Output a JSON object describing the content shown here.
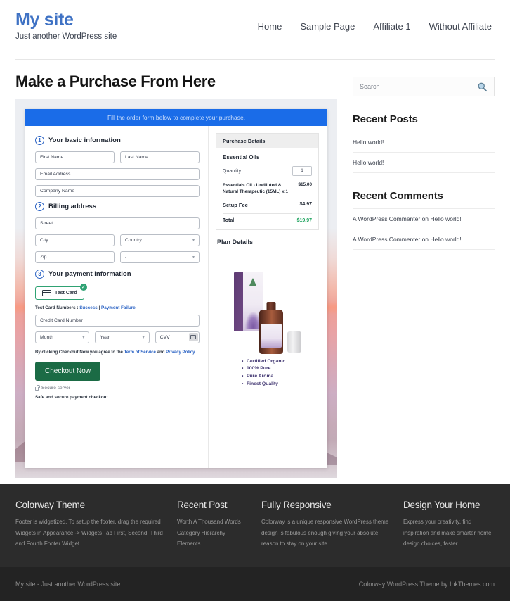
{
  "header": {
    "site_title": "My site",
    "tagline": "Just another WordPress site",
    "nav": [
      {
        "label": "Home"
      },
      {
        "label": "Sample Page"
      },
      {
        "label": "Affiliate 1"
      },
      {
        "label": "Without Affiliate"
      }
    ]
  },
  "main": {
    "page_title": "Make a Purchase From Here",
    "checkout": {
      "banner": "Fill the order form below to complete your purchase.",
      "steps": {
        "one_num": "1",
        "one_label": "Your basic information",
        "two_num": "2",
        "two_label": "Billing address",
        "three_num": "3",
        "three_label": "Your payment information"
      },
      "fields": {
        "first_name": "First Name",
        "last_name": "Last Name",
        "email": "Email Address",
        "company": "Company Name",
        "street": "Street",
        "city": "City",
        "country": "Country",
        "zip": "Zip",
        "state": "-",
        "credit_card": "Credit Card Number",
        "month": "Month",
        "year": "Year",
        "cvv": "CVV"
      },
      "payment": {
        "card_tab_label": "Test Card",
        "check_glyph": "✓",
        "test_numbers_prefix": "Test Card Numbers : ",
        "test_success": "Success",
        "test_divider": " | ",
        "test_failure": "Payment Failure",
        "terms_prefix": "By clicking Checkout Now you agree to the ",
        "terms_tos": "Term of Service",
        "terms_and": " and ",
        "terms_privacy": "Privacy Policy",
        "checkout_button": "Checkout Now",
        "secure_server": "Secure server",
        "safe_note": "Safe and secure payment checkout."
      },
      "purchase_details": {
        "panel_title": "Purchase Details",
        "product_name": "Essential Oils",
        "quantity_label": "Quantity",
        "quantity_value": "1",
        "line_desc": "Essentials Oil - Undiluted & Natural Therapeutic (15ML) x 1",
        "line_amount": "$15.00",
        "setup_fee_label": "Setup Fee",
        "setup_fee_amount": "$4.97",
        "total_label": "Total",
        "total_amount": "$19.97",
        "total_color": "#18a05a"
      },
      "plan": {
        "title": "Plan Details",
        "bullets": [
          {
            "label": "Certified Organic"
          },
          {
            "label": "100% Pure"
          },
          {
            "label": "Pure Aroma"
          },
          {
            "label": "Finest Quality"
          }
        ]
      }
    }
  },
  "sidebar": {
    "search_placeholder": "Search",
    "search_icon": "search-icon",
    "recent_posts": {
      "title": "Recent Posts",
      "items": [
        {
          "label": "Hello world!"
        },
        {
          "label": "Hello world!"
        }
      ]
    },
    "recent_comments": {
      "title": "Recent Comments",
      "items": [
        {
          "label": "A WordPress Commenter on Hello world!"
        },
        {
          "label": "A WordPress Commenter on Hello world!"
        }
      ]
    }
  },
  "footer": {
    "columns": [
      {
        "title": "Colorway Theme",
        "text": "Footer is widgetized. To setup the footer, drag the required Widgets in Appearance -> Widgets Tab First, Second, Third and Fourth Footer Widget"
      },
      {
        "title": "Recent Post",
        "items": [
          {
            "label": "Worth A Thousand Words"
          },
          {
            "label": "Category Hierarchy"
          },
          {
            "label": "Elements"
          }
        ]
      },
      {
        "title": "Fully Responsive",
        "text": "Colorway is a unique responsive WordPress theme design is fabulous enough giving your absolute reason to stay on your site."
      },
      {
        "title": "Design Your Home",
        "text": "Express your creativity, find inspiration and make smarter home design choices, faster."
      }
    ],
    "copyright_left": "My site - Just another WordPress site",
    "copyright_right": "Colorway WordPress Theme by InkThemes.com"
  }
}
